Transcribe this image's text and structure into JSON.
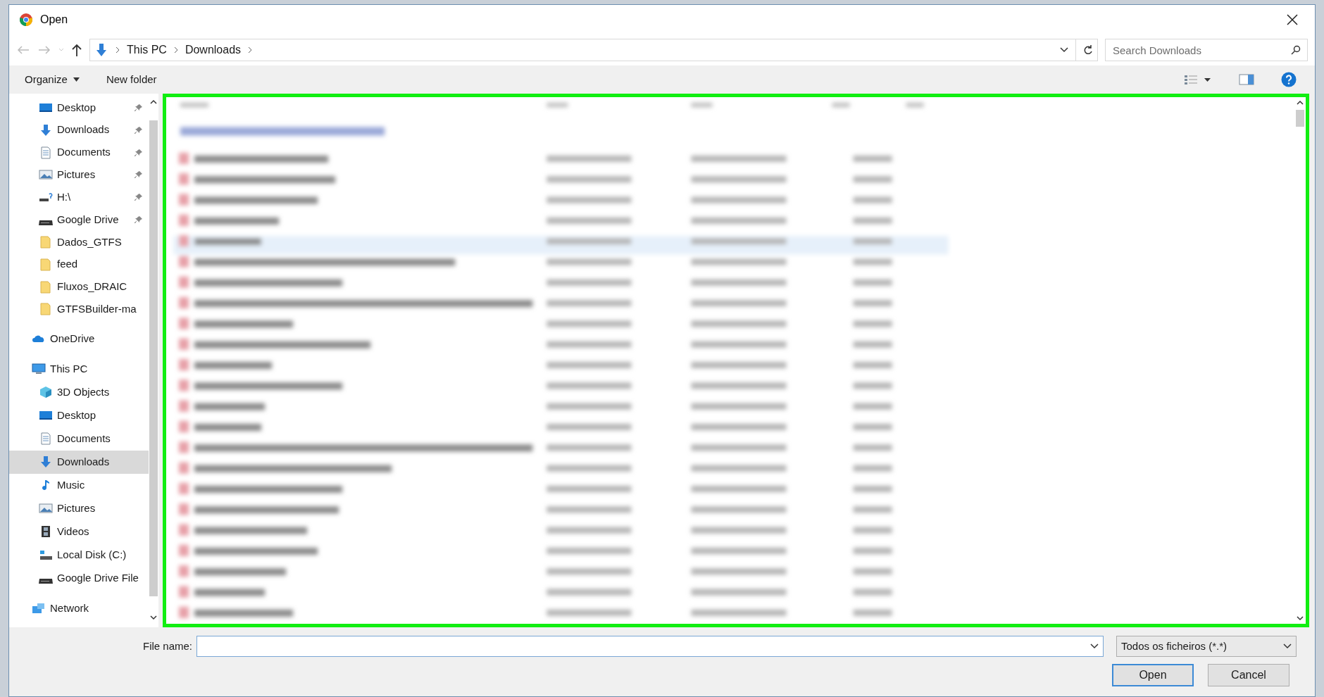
{
  "window": {
    "title": "Open"
  },
  "address": {
    "path": [
      "This PC",
      "Downloads"
    ]
  },
  "search": {
    "placeholder": "Search Downloads"
  },
  "toolbar": {
    "organize": "Organize",
    "new_folder": "New folder"
  },
  "nav": {
    "quick_access": [
      {
        "label": "Desktop",
        "kind": "desktop",
        "pinned": true
      },
      {
        "label": "Downloads",
        "kind": "download",
        "pinned": true
      },
      {
        "label": "Documents",
        "kind": "document",
        "pinned": true
      },
      {
        "label": "Pictures",
        "kind": "pictures",
        "pinned": true
      },
      {
        "label": "H:\\",
        "kind": "netdrive",
        "pinned": true
      },
      {
        "label": "Google Drive",
        "kind": "drive",
        "pinned": true
      },
      {
        "label": "Dados_GTFS",
        "kind": "folder",
        "pinned": false
      },
      {
        "label": "feed",
        "kind": "folder",
        "pinned": false
      },
      {
        "label": "Fluxos_DRAIC",
        "kind": "folder",
        "pinned": false
      },
      {
        "label": "GTFSBuilder-ma",
        "kind": "folder",
        "pinned": false
      }
    ],
    "roots": [
      {
        "label": "OneDrive",
        "kind": "cloud",
        "selected": false
      },
      {
        "label": "This PC",
        "kind": "pc",
        "selected": false,
        "children": [
          {
            "label": "3D Objects",
            "kind": "cube",
            "selected": false
          },
          {
            "label": "Desktop",
            "kind": "desktop",
            "selected": false
          },
          {
            "label": "Documents",
            "kind": "document",
            "selected": false
          },
          {
            "label": "Downloads",
            "kind": "download",
            "selected": true
          },
          {
            "label": "Music",
            "kind": "music",
            "selected": false
          },
          {
            "label": "Pictures",
            "kind": "pictures",
            "selected": false
          },
          {
            "label": "Videos",
            "kind": "video",
            "selected": false
          },
          {
            "label": "Local Disk (C:)",
            "kind": "disk",
            "selected": false
          },
          {
            "label": "Google Drive File",
            "kind": "drive",
            "selected": false
          }
        ]
      },
      {
        "label": "Network",
        "kind": "network",
        "selected": false
      }
    ]
  },
  "file_list": {
    "kind": "blurred"
  },
  "file_name": {
    "label": "File name:"
  },
  "file_type": {
    "value": "Todos os ficheiros (*.*)"
  },
  "buttons": {
    "open": "Open",
    "cancel": "Cancel"
  }
}
